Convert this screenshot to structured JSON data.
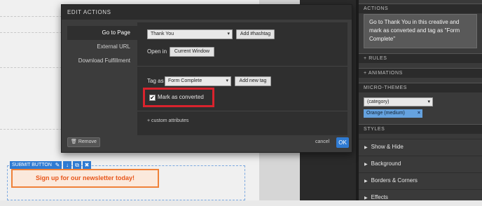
{
  "modal": {
    "title": "EDIT ACTIONS",
    "action_types": [
      "Go to Page",
      "External URL",
      "Download Fulfillment"
    ],
    "page_select": "Thank You",
    "add_hashtag": "Add #hashtag",
    "open_in_label": "Open in",
    "open_in_value": "Current Window",
    "tag_as_label": "Tag as",
    "tag_select": "Form Complete",
    "add_new_tag": "Add new tag",
    "checkbox_checked": true,
    "checkmark": "✔",
    "mark_converted": "Mark as converted",
    "custom_attributes": "+ custom attributes",
    "remove": "Remove",
    "cancel": "cancel",
    "ok": "OK"
  },
  "canvas": {
    "submit_button_tag": "SUBMIT BUTTON",
    "signup_text": "Sign up for our newsletter today!"
  },
  "panel": {
    "actions_header": "ACTIONS",
    "actions_text": "Go to Thank You in this creative and mark as converted and tag as \"Form Complete\"",
    "rules_header": "+ RULES",
    "animations_header": "+ ANIMATIONS",
    "micro_themes_header": "MICRO-THEMES",
    "category_select": "(category)",
    "theme_tag": "Orange (medium)",
    "theme_remove": "×",
    "styles_header": "STYLES",
    "style_items": [
      "Show & Hide",
      "Background",
      "Borders & Corners",
      "Effects"
    ]
  },
  "colors": {
    "accent_blue": "#2f7bd3",
    "highlight_red": "#d9232d",
    "signup_orange": "#f08138"
  }
}
